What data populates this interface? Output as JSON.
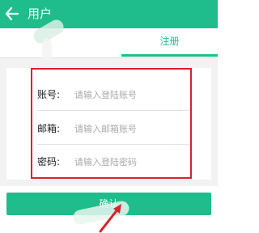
{
  "header": {
    "title": "用户",
    "back_icon": "arrow-left-icon"
  },
  "tabs": {
    "register_label": "注册",
    "active": "register"
  },
  "form": {
    "account": {
      "label": "账号:",
      "placeholder": "请输入登陆账号"
    },
    "email": {
      "label": "邮箱:",
      "placeholder": "请输入邮箱账号"
    },
    "password": {
      "label": "密码:",
      "placeholder": "请输入登陆密码"
    }
  },
  "confirm_button": {
    "label": "确认"
  },
  "colors": {
    "primary": "#1fbd8b",
    "highlight": "#d8232a",
    "background": "#f2f2f2"
  },
  "annotations": {
    "arrow_icon": "red-arrow-pointer-icon"
  }
}
